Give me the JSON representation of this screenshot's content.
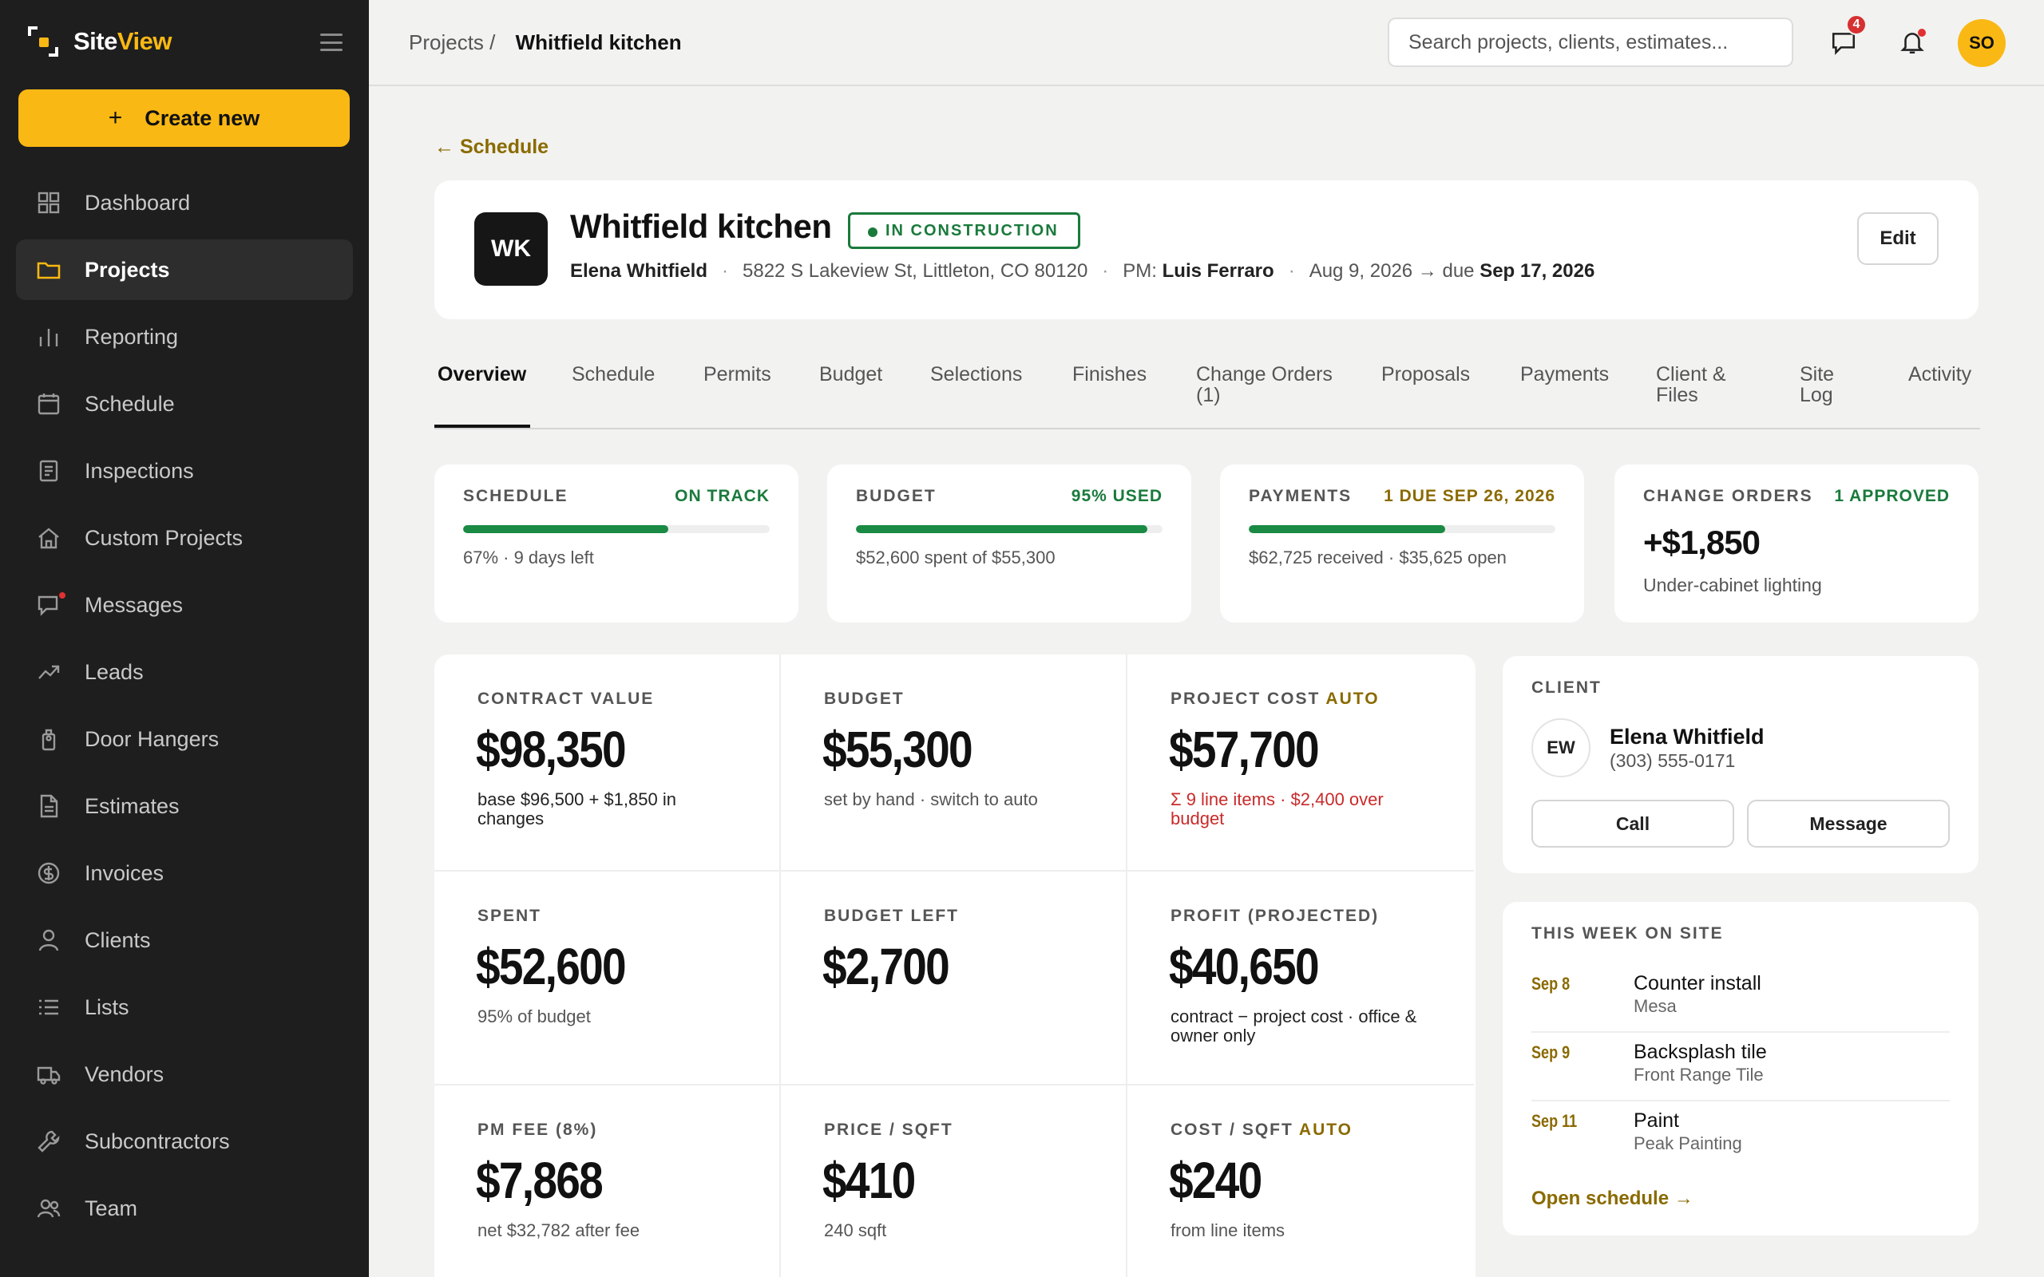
{
  "brand": {
    "name_a": "Site",
    "name_b": "View",
    "accent": "#f9b813"
  },
  "sidebar": {
    "create_label": "Create new",
    "create_icon": "+",
    "items": [
      {
        "label": "Dashboard",
        "icon": "grid-icon"
      },
      {
        "label": "Projects",
        "icon": "folder-icon",
        "active": true
      },
      {
        "label": "Reporting",
        "icon": "bar-chart-icon"
      },
      {
        "label": "Schedule",
        "icon": "calendar-icon"
      },
      {
        "label": "Inspections",
        "icon": "clipboard-icon"
      },
      {
        "label": "Custom Projects",
        "icon": "house-icon"
      },
      {
        "label": "Messages",
        "icon": "chat-icon"
      },
      {
        "label": "Leads",
        "icon": "trend-icon"
      },
      {
        "label": "Door Hangers",
        "icon": "tag-icon"
      },
      {
        "label": "Estimates",
        "icon": "document-icon"
      },
      {
        "label": "Invoices",
        "icon": "dollar-icon"
      },
      {
        "label": "Clients",
        "icon": "person-icon"
      },
      {
        "label": "Lists",
        "icon": "list-icon"
      },
      {
        "label": "Vendors",
        "icon": "truck-icon"
      },
      {
        "label": "Subcontractors",
        "icon": "wrench-icon"
      },
      {
        "label": "Team",
        "icon": "team-icon"
      }
    ]
  },
  "topbar": {
    "crumb_parent": "Projects /",
    "crumb_current": "Whitfield kitchen",
    "search_placeholder": "Search projects, clients, estimates...",
    "messages_badge": "4",
    "avatar_initials": "SO"
  },
  "project": {
    "back_label": "← Schedule",
    "initials": "WK",
    "title": "Whitfield kitchen",
    "status": "IN CONSTRUCTION",
    "client": "Elena Whitfield",
    "address": "5822 S Lakeview St, Littleton, CO 80120",
    "pm_label": "PM:",
    "pm": "Luis Ferraro",
    "dates_prefix": "Aug 9, 2026 → due",
    "due": "Sep 17, 2026",
    "edit_label": "Edit"
  },
  "tabs": [
    {
      "label": "Overview",
      "active": true
    },
    {
      "label": "Schedule"
    },
    {
      "label": "Permits"
    },
    {
      "label": "Budget"
    },
    {
      "label": "Selections"
    },
    {
      "label": "Finishes"
    },
    {
      "label": "Change Orders (1)"
    },
    {
      "label": "Proposals"
    },
    {
      "label": "Payments"
    },
    {
      "label": "Client & Files"
    },
    {
      "label": "Site Log"
    },
    {
      "label": "Activity"
    }
  ],
  "summary": [
    {
      "label": "SCHEDULE",
      "status": "ON TRACK",
      "progress_pct": 67,
      "note": "67% · 9 days left"
    },
    {
      "label": "BUDGET",
      "status": "95% USED",
      "progress_pct": 95,
      "note": "$52,600 spent of $55,300"
    },
    {
      "label": "PAYMENTS",
      "status": "1 DUE SEP 26, 2026",
      "progress_pct": 64,
      "note": "$62,725 received · $35,625 open"
    },
    {
      "label": "CHANGE ORDERS",
      "status": "1 APPROVED",
      "value": "+$1,850",
      "note": "Under-cabinet lighting"
    }
  ],
  "metrics": [
    {
      "label": "CONTRACT VALUE",
      "value": "$98,350",
      "note": "base $96,500 + $1,850 in changes"
    },
    {
      "label": "BUDGET",
      "value": "$55,300",
      "note": "set by hand · switch to auto"
    },
    {
      "label": "PROJECT COST",
      "auto": "AUTO",
      "value": "$57,700",
      "note": "Σ 9 line items · $2,400 over budget"
    },
    {
      "label": "SPENT",
      "value": "$52,600",
      "note": "95% of budget"
    },
    {
      "label": "BUDGET LEFT",
      "value": "$2,700",
      "note": ""
    },
    {
      "label": "PROFIT (PROJECTED)",
      "value": "$40,650",
      "note": "contract − project cost · office & owner only"
    },
    {
      "label": "PM FEE (8%)",
      "value": "$7,868",
      "note": "net $32,782 after fee"
    },
    {
      "label": "PRICE / SQFT",
      "value": "$410",
      "note": "240 sqft"
    },
    {
      "label": "COST / SQFT",
      "auto": "AUTO",
      "value": "$240",
      "note": "from line items"
    }
  ],
  "client_card": {
    "label": "CLIENT",
    "initials": "EW",
    "name": "Elena Whitfield",
    "phone": "(303) 555-0171",
    "call_label": "Call",
    "message_label": "Message"
  },
  "week": {
    "label": "THIS WEEK ON SITE",
    "items": [
      {
        "date": "Sep 8",
        "task": "Counter install",
        "who": "Mesa"
      },
      {
        "date": "Sep 9",
        "task": "Backsplash tile",
        "who": "Front Range Tile"
      },
      {
        "date": "Sep 11",
        "task": "Paint",
        "who": "Peak Painting"
      }
    ],
    "link": "Open schedule →"
  },
  "colors": {
    "gold": "#8a6a00",
    "green": "#1a7a3c",
    "red": "#c92a2a",
    "sidebar": "#1e1e1e"
  }
}
